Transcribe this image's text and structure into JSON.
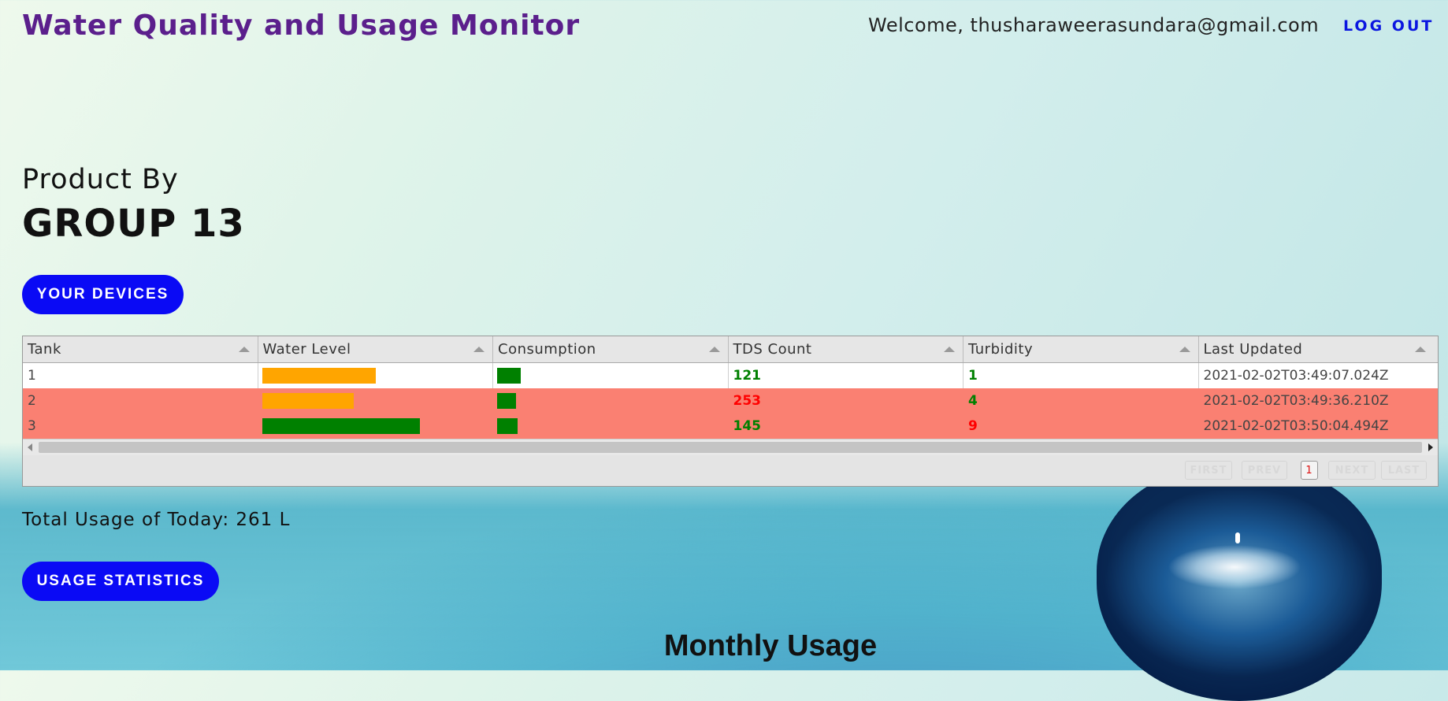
{
  "header": {
    "title": "Water Quality and Usage Monitor",
    "welcome": "Welcome, thusharaweerasundara@gmail.com",
    "logout_label": "LOG OUT"
  },
  "branding": {
    "product_by": "Product By",
    "group": "GROUP 13"
  },
  "buttons": {
    "devices_label": "YOUR DEVICES",
    "stats_label": "USAGE STATISTICS"
  },
  "devices_table": {
    "columns": [
      "Tank",
      "Water Level",
      "Consumption",
      "TDS Count",
      "Turbidity",
      "Last Updated"
    ],
    "rows": [
      {
        "tank": "1",
        "water_level": 0.72,
        "water_level_color": "#ffa500",
        "consumption": 0.15,
        "consumption_color": "#008000",
        "tds": "121",
        "tds_color": "#008000",
        "turbidity": "1",
        "turbidity_color": "#008000",
        "last_updated": "2021-02-02T03:49:07.024Z",
        "row_alert": false
      },
      {
        "tank": "2",
        "water_level": 0.58,
        "water_level_color": "#ffa500",
        "consumption": 0.12,
        "consumption_color": "#008000",
        "tds": "253",
        "tds_color": "#ff0000",
        "turbidity": "4",
        "turbidity_color": "#008000",
        "last_updated": "2021-02-02T03:49:36.210Z",
        "row_alert": true
      },
      {
        "tank": "3",
        "water_level": 1.0,
        "water_level_color": "#008000",
        "consumption": 0.13,
        "consumption_color": "#008000",
        "tds": "145",
        "tds_color": "#008000",
        "turbidity": "9",
        "turbidity_color": "#ff0000",
        "last_updated": "2021-02-02T03:50:04.494Z",
        "row_alert": true
      }
    ],
    "pager": {
      "first": "FIRST",
      "prev": "PREV",
      "current": "1",
      "next": "NEXT",
      "last": "LAST"
    }
  },
  "usage": {
    "total_today": "Total Usage of Today: 261 L"
  },
  "monthly": {
    "heading": "Monthly Usage"
  },
  "colors": {
    "brand_purple": "#5b1f8c",
    "button_blue": "#0a0af5",
    "alert_row": "#fa8072"
  }
}
